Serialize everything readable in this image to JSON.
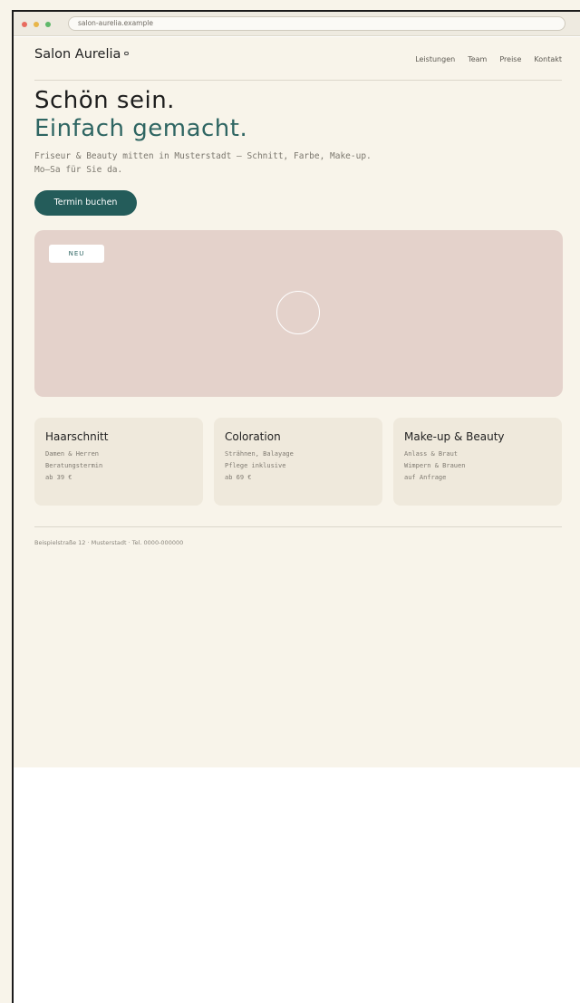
{
  "browser": {
    "url": "salon-aurelia.example"
  },
  "header": {
    "brand": "Salon Aurelia",
    "nav": [
      "Leistungen",
      "Team",
      "Preise",
      "Kontakt"
    ]
  },
  "hero": {
    "title_line1": "Schön sein.",
    "title_line2": "Einfach gemacht.",
    "subtitle_line1": "Friseur & Beauty mitten in Musterstadt — Schnitt, Farbe, Make-up.",
    "subtitle_line2": "Mo–Sa für Sie da.",
    "cta_label": "Termin buchen",
    "badge": "NEU"
  },
  "services": [
    {
      "title": "Haarschnitt",
      "lines": [
        "Damen & Herren",
        "Beratungstermin",
        "ab 39 €"
      ]
    },
    {
      "title": "Coloration",
      "lines": [
        "Strähnen, Balayage",
        "Pflege inklusive",
        "ab 69 €"
      ]
    },
    {
      "title": "Make-up & Beauty",
      "lines": [
        "Anlass & Braut",
        "Wimpern & Brauen",
        "auf Anfrage"
      ]
    }
  ],
  "footer": {
    "text": "Beispielstraße 12 · Musterstadt · Tel. 0000-000000"
  },
  "colors": {
    "accent": "#245c5a",
    "hero_bg": "#e4d2cb",
    "page_bg": "#f8f4ea",
    "card_bg": "#efe9dc"
  }
}
